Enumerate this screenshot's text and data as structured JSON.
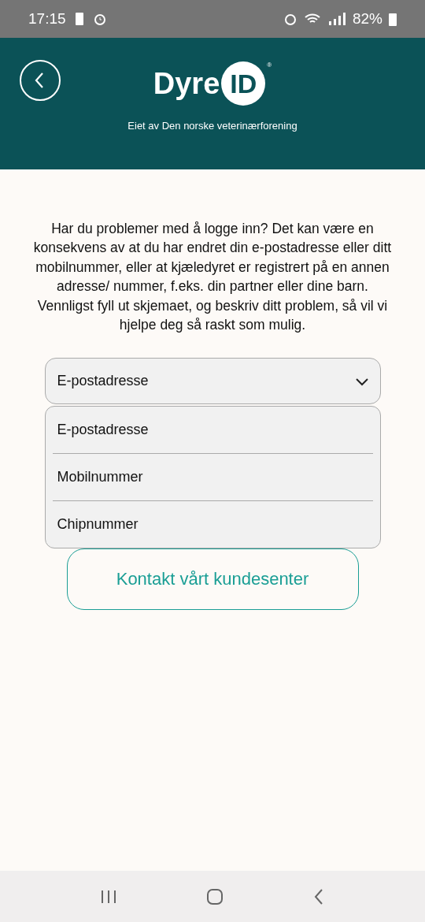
{
  "status_bar": {
    "time": "17:15",
    "battery": "82%"
  },
  "header": {
    "logo_word": "Dyre",
    "logo_badge": "ID",
    "logo_mark": "®",
    "subtitle": "Eiet av Den norske veterinærforening"
  },
  "intro": "Har du problemer med å logge inn? Det kan være en konsekvens av at du har endret din e-postadresse eller ditt mobilnummer, eller at kjæledyret er registrert på en annen adresse/ nummer, f.eks. din partner eller dine barn. Vennligst fyll ut skjemaet, og beskriv ditt problem, så vil vi hjelpe deg så raskt som mulig.",
  "dropdown": {
    "value": "E-postadresse",
    "expanded": true,
    "options": [
      "E-postadresse",
      "Mobilnummer",
      "Chipnummer"
    ]
  },
  "contact_button": "Kontakt vårt kundesenter"
}
